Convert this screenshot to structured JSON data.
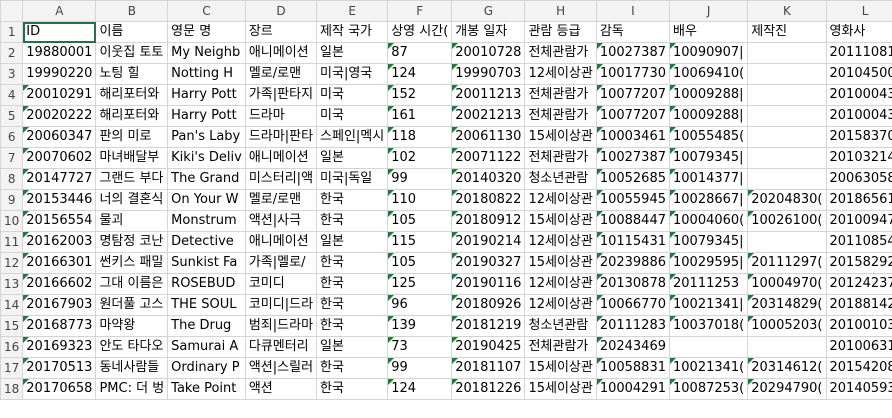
{
  "columns": [
    "A",
    "B",
    "C",
    "D",
    "E",
    "F",
    "G",
    "H",
    "I",
    "J",
    "K",
    "L"
  ],
  "rows": [
    {
      "n": "1",
      "cells": [
        "ID",
        "이름",
        "영문 명",
        "장르",
        "제작 국가",
        "상영 시간(",
        "개봉 일자",
        "관람 등급",
        "감독",
        "배우",
        "제작진",
        "영화사"
      ],
      "tri": [
        false,
        false,
        false,
        false,
        false,
        false,
        false,
        false,
        false,
        false,
        false,
        false
      ]
    },
    {
      "n": "2",
      "cells": [
        "19880001",
        "이웃집 토토",
        "My Neighb",
        "애니메이션",
        "일본",
        "87",
        "20010728",
        "전체관람가",
        "10027387",
        "10090907|",
        "",
        "20111081("
      ],
      "tri": [
        false,
        false,
        false,
        false,
        false,
        true,
        true,
        false,
        true,
        true,
        false,
        false
      ]
    },
    {
      "n": "3",
      "cells": [
        "19990220",
        "노팅 힐",
        "Notting H",
        "멜로/로맨",
        "미국|영국",
        "124",
        "19990703",
        "12세이상관",
        "10017730",
        "10069410(",
        "",
        "20104500("
      ],
      "tri": [
        false,
        false,
        false,
        false,
        false,
        true,
        true,
        false,
        true,
        true,
        false,
        false
      ]
    },
    {
      "n": "4",
      "cells": [
        "20010291",
        "해리포터와",
        "Harry Pott",
        "가족|판타지",
        "미국",
        "152",
        "20011213",
        "전체관람가",
        "10077207",
        "10009288|",
        "",
        "20100043("
      ],
      "tri": [
        true,
        false,
        false,
        false,
        false,
        true,
        true,
        false,
        true,
        true,
        false,
        false
      ]
    },
    {
      "n": "5",
      "cells": [
        "20020222",
        "해리포터와",
        "Harry Pott",
        "드라마",
        "미국",
        "161",
        "20021213",
        "전체관람가",
        "10077207",
        "10009288|",
        "",
        "20100043("
      ],
      "tri": [
        true,
        false,
        false,
        false,
        false,
        true,
        true,
        false,
        true,
        true,
        false,
        false
      ]
    },
    {
      "n": "6",
      "cells": [
        "20060347",
        "판의 미로",
        "Pan's Laby",
        "드라마|판타",
        "스페인|멕시",
        "118",
        "20061130",
        "15세이상관",
        "10003461",
        "10055485(",
        "",
        "20158370("
      ],
      "tri": [
        true,
        false,
        false,
        false,
        false,
        true,
        true,
        false,
        true,
        true,
        false,
        false
      ]
    },
    {
      "n": "7",
      "cells": [
        "20070602",
        "마녀배달부",
        "Kiki's Deliv",
        "애니메이션",
        "일본",
        "102",
        "20071122",
        "전체관람가",
        "10027387",
        "10079345|",
        "",
        "20103214("
      ],
      "tri": [
        true,
        false,
        false,
        false,
        false,
        true,
        true,
        false,
        true,
        true,
        false,
        false
      ]
    },
    {
      "n": "8",
      "cells": [
        "20147727",
        "그랜드 부다",
        "The Grand",
        "미스터리|액",
        "미국|독일",
        "99",
        "20140320",
        "청소년관람",
        "10052685",
        "10014377|",
        "",
        "20063058("
      ],
      "tri": [
        true,
        false,
        false,
        false,
        false,
        true,
        true,
        false,
        true,
        true,
        false,
        false
      ]
    },
    {
      "n": "9",
      "cells": [
        "20153446",
        "너의 결혼식",
        "On Your W",
        "멜로/로맨",
        "한국",
        "110",
        "20180822",
        "12세이상관",
        "10055945",
        "10028667|",
        "20204830(",
        "20186561("
      ],
      "tri": [
        true,
        false,
        false,
        false,
        false,
        true,
        true,
        false,
        true,
        true,
        true,
        false
      ]
    },
    {
      "n": "10",
      "cells": [
        "20156554",
        "물괴",
        "Monstrum",
        "액션|사극",
        "한국",
        "105",
        "20180912",
        "15세이상관",
        "10088447",
        "10004060(",
        "10026100(",
        "20100947("
      ],
      "tri": [
        true,
        false,
        false,
        false,
        false,
        true,
        true,
        false,
        true,
        true,
        true,
        false
      ]
    },
    {
      "n": "11",
      "cells": [
        "20162003",
        "명탐정 코난",
        "Detective",
        "애니메이션",
        "일본",
        "115",
        "20190214",
        "12세이상관",
        "10115431",
        "10079345|",
        "",
        "20110854("
      ],
      "tri": [
        true,
        false,
        false,
        false,
        false,
        true,
        true,
        false,
        true,
        true,
        false,
        false
      ]
    },
    {
      "n": "12",
      "cells": [
        "20166301",
        "썬키스 패밀",
        "Sunkist Fa",
        "가족|멜로/",
        "한국",
        "105",
        "20190327",
        "15세이상관",
        "20239886",
        "10029595|",
        "20111297(",
        "20158292("
      ],
      "tri": [
        true,
        false,
        false,
        false,
        false,
        true,
        true,
        false,
        true,
        true,
        true,
        false
      ]
    },
    {
      "n": "13",
      "cells": [
        "20166602",
        "그대 이름은",
        "ROSEBUD",
        "코미디",
        "한국",
        "125",
        "20190116",
        "12세이상관",
        "20130878",
        "20111253",
        "10004970(",
        "20124237("
      ],
      "tri": [
        true,
        false,
        false,
        false,
        false,
        true,
        true,
        false,
        true,
        true,
        true,
        false
      ]
    },
    {
      "n": "14",
      "cells": [
        "20167903",
        "원더풀 고스",
        "THE SOUL",
        "코미디|드라",
        "한국",
        "96",
        "20180926",
        "12세이상관",
        "10066770",
        "10021341|",
        "20314829(",
        "20188142("
      ],
      "tri": [
        true,
        false,
        false,
        false,
        false,
        true,
        true,
        false,
        true,
        true,
        true,
        false
      ]
    },
    {
      "n": "15",
      "cells": [
        "20168773",
        "마약왕",
        "The Drug",
        "범죄|드라마",
        "한국",
        "139",
        "20181219",
        "청소년관람",
        "20111283",
        "10037018(",
        "10005203(",
        "20100103("
      ],
      "tri": [
        true,
        false,
        false,
        false,
        false,
        true,
        true,
        false,
        true,
        true,
        true,
        false
      ]
    },
    {
      "n": "16",
      "cells": [
        "20169323",
        "안도 타다오",
        "Samurai A",
        "다큐멘터리",
        "일본",
        "73",
        "20190425",
        "전체관람가",
        "20243469",
        "",
        "",
        "20100631("
      ],
      "tri": [
        true,
        false,
        false,
        false,
        false,
        true,
        true,
        false,
        true,
        false,
        false,
        false
      ]
    },
    {
      "n": "17",
      "cells": [
        "20170513",
        "동네사람들",
        "Ordinary P",
        "액션|스릴러",
        "한국",
        "99",
        "20181107",
        "15세이상관",
        "10058831",
        "10021341(",
        "20314612(",
        "20154208("
      ],
      "tri": [
        true,
        false,
        false,
        false,
        false,
        true,
        true,
        false,
        true,
        true,
        true,
        false
      ]
    },
    {
      "n": "18",
      "cells": [
        "20170658",
        "PMC: 더 벙",
        "Take Point",
        "액션",
        "한국",
        "124",
        "20181226",
        "15세이상관",
        "10004291",
        "10087253(",
        "20294790(",
        "20140593("
      ],
      "tri": [
        true,
        false,
        false,
        false,
        false,
        true,
        true,
        false,
        true,
        true,
        true,
        false
      ]
    }
  ]
}
